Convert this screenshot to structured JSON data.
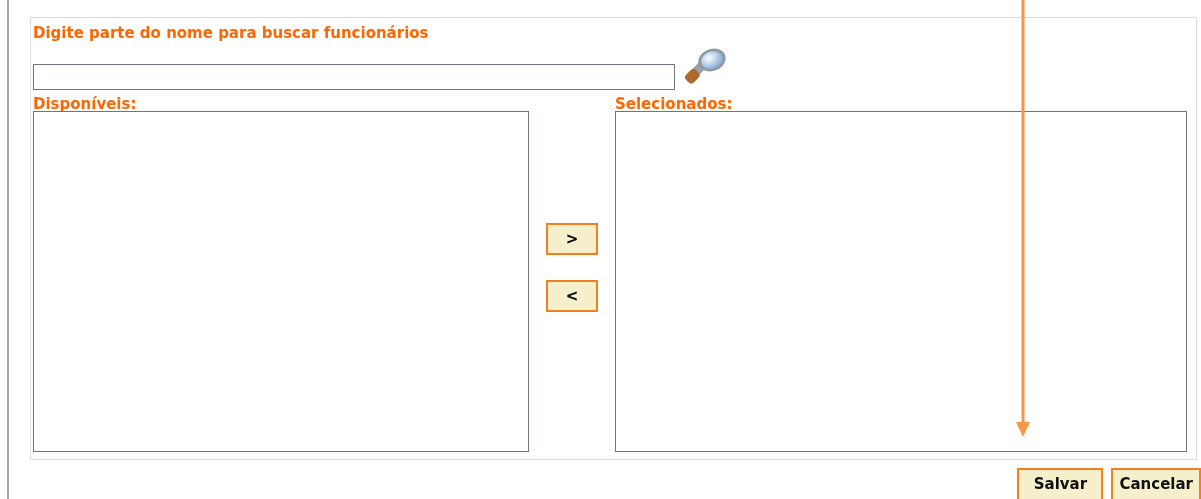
{
  "search": {
    "label": "Digite parte do nome para buscar funcionários"
  },
  "available": {
    "label": "Disponíveis:"
  },
  "selected": {
    "label": "Selecionados:"
  },
  "move_buttons": [
    {
      "label": ">"
    },
    {
      "label": "<"
    }
  ],
  "footer_buttons": [
    {
      "label": "Salvar"
    },
    {
      "label": "Cancelar"
    }
  ]
}
